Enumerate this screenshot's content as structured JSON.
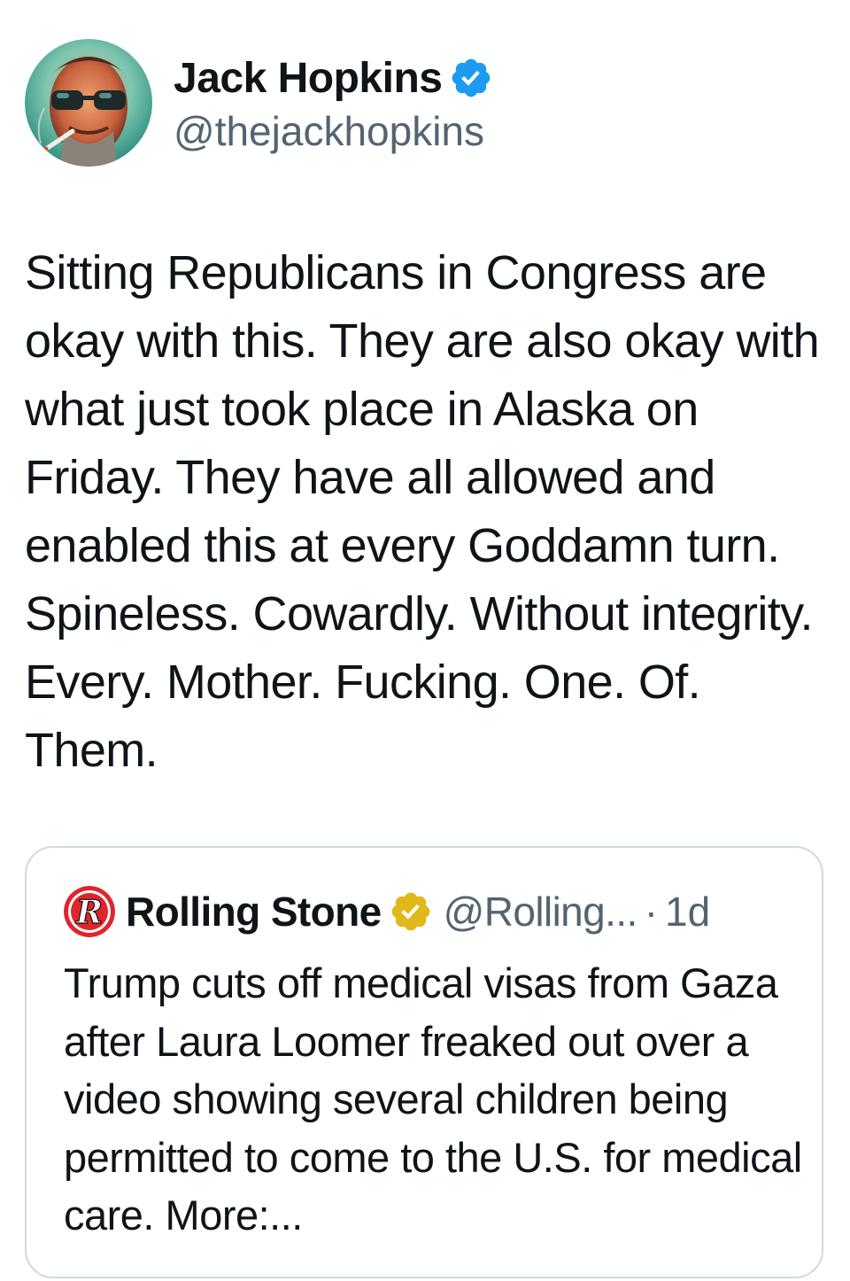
{
  "tweet": {
    "author": {
      "display_name": "Jack Hopkins",
      "handle": "@thejackhopkins",
      "verified": true,
      "verified_badge_color": "#1d9bf0"
    },
    "text": "Sitting Republicans in Congress are okay with this. They are also okay with what just took place in Alaska on Friday. They have all allowed and enabled this at every Goddamn turn. Spineless. Cowardly. Without integrity. Every. Mother. Fucking. One. Of. Them."
  },
  "quoted_tweet": {
    "author": {
      "display_name": "Rolling Stone",
      "handle": "@Rolling...",
      "verified": true,
      "verified_badge_color": "#e2b719",
      "logo_letter": "R",
      "logo_color": "#e0242b"
    },
    "separator": "·",
    "time": "1d",
    "text": "Trump cuts off medical visas from Gaza after Laura Loomer freaked out over a video showing several children being permitted to come to the U.S. for medical care. More:..."
  },
  "colors": {
    "text_primary": "#0f1419",
    "text_secondary": "#536471",
    "border": "#cfd9de",
    "background": "#ffffff"
  }
}
